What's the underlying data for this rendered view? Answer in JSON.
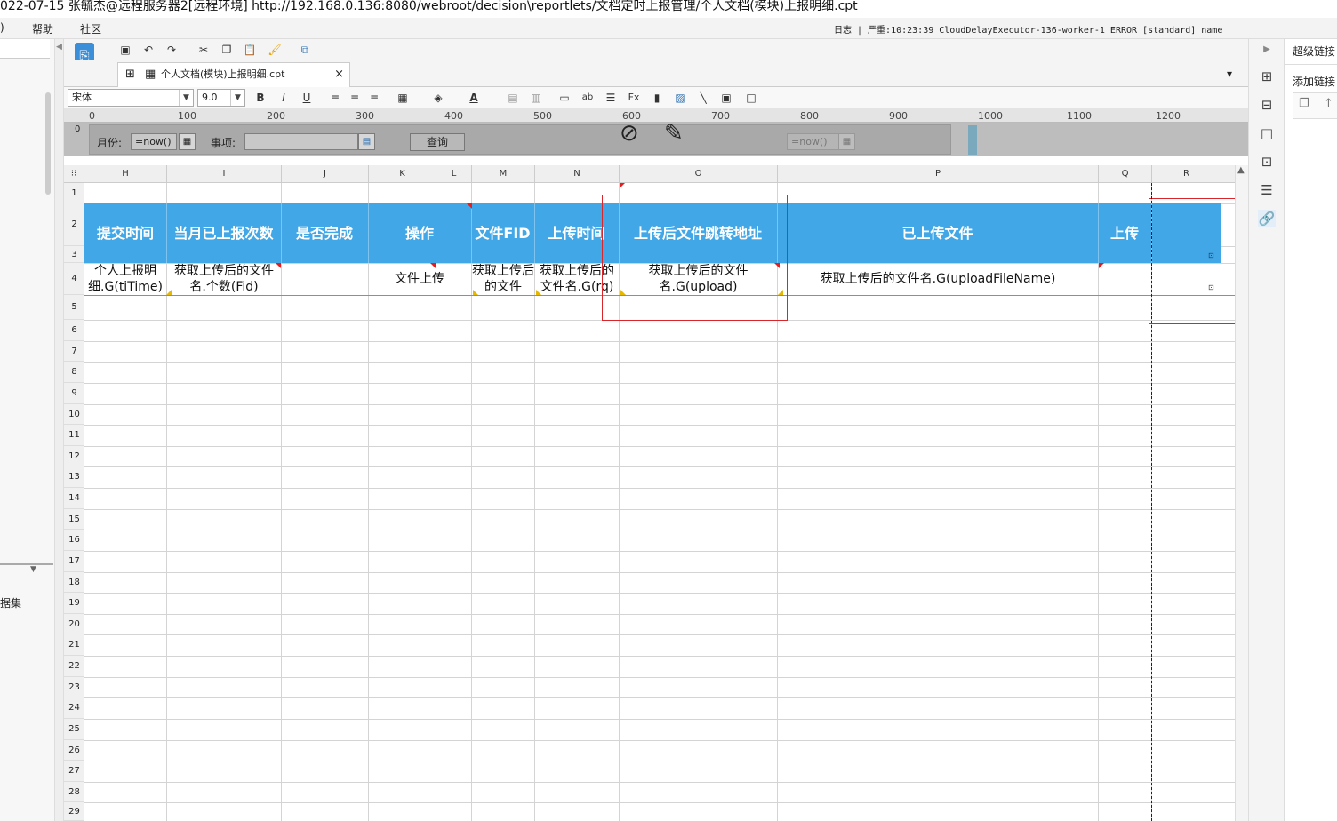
{
  "window": {
    "title": "022-07-15 张毓杰@远程服务器2[远程环境]    http://192.168.0.136:8080/webroot/decision\\reportlets/文档定时上报管理/个人文档(模块)上报明细.cpt"
  },
  "menu": {
    "item0": ")",
    "help": "帮助",
    "community": "社区"
  },
  "log": {
    "text": "日志 | 严重:10:23:39 CloudDelayExecutor-136-worker-1 ERROR [standard] name"
  },
  "left": {
    "dataset_label": "据集"
  },
  "tab": {
    "label": "个人文档(模块)上报明细.cpt",
    "close": "×"
  },
  "format": {
    "font": "宋体",
    "size": "9.0"
  },
  "ruler": [
    "0",
    "100",
    "200",
    "300",
    "400",
    "500",
    "600",
    "700",
    "800",
    "900",
    "1000",
    "1100",
    "1200"
  ],
  "params": {
    "month_label": "月份:",
    "month_value": "=now()",
    "item_label": "事项:",
    "query_button": "查询",
    "hidden_value": "=now()",
    "ruler_side": "0"
  },
  "columns": [
    "H",
    "I",
    "J",
    "K",
    "L",
    "M",
    "N",
    "O",
    "P",
    "Q",
    "R"
  ],
  "rows": [
    "1",
    "2",
    "3",
    "4",
    "5",
    "6",
    "7",
    "8",
    "9",
    "10",
    "11",
    "12",
    "13",
    "14",
    "15",
    "16",
    "17",
    "18",
    "19",
    "20",
    "21",
    "22",
    "23",
    "24",
    "25",
    "26",
    "27",
    "28",
    "29"
  ],
  "headers": {
    "h": "提交时间",
    "i": "当月已上报次数",
    "j": "是否完成",
    "k": "操作",
    "m": "文件FID",
    "n": "上传时间",
    "o": "上传后文件跳转地址",
    "p": "已上传文件",
    "q": "上传"
  },
  "cells": {
    "h4": "个人上报明细.G(tiTime)",
    "i4": "获取上传后的文件名.个数(Fid)",
    "k4": "文件上传",
    "m4": "获取上传后的文件",
    "n4": "获取上传后的文件名.G(rq)",
    "o4": "获取上传后的文件名.G(upload)",
    "p4": "获取上传后的文件名.G(uploadFileName)"
  },
  "right_panel": {
    "hyperlink": "超级链接",
    "add_link": "添加链接"
  },
  "colors": {
    "header_blue": "#41a7e7",
    "highlight_red": "#d9262a"
  }
}
